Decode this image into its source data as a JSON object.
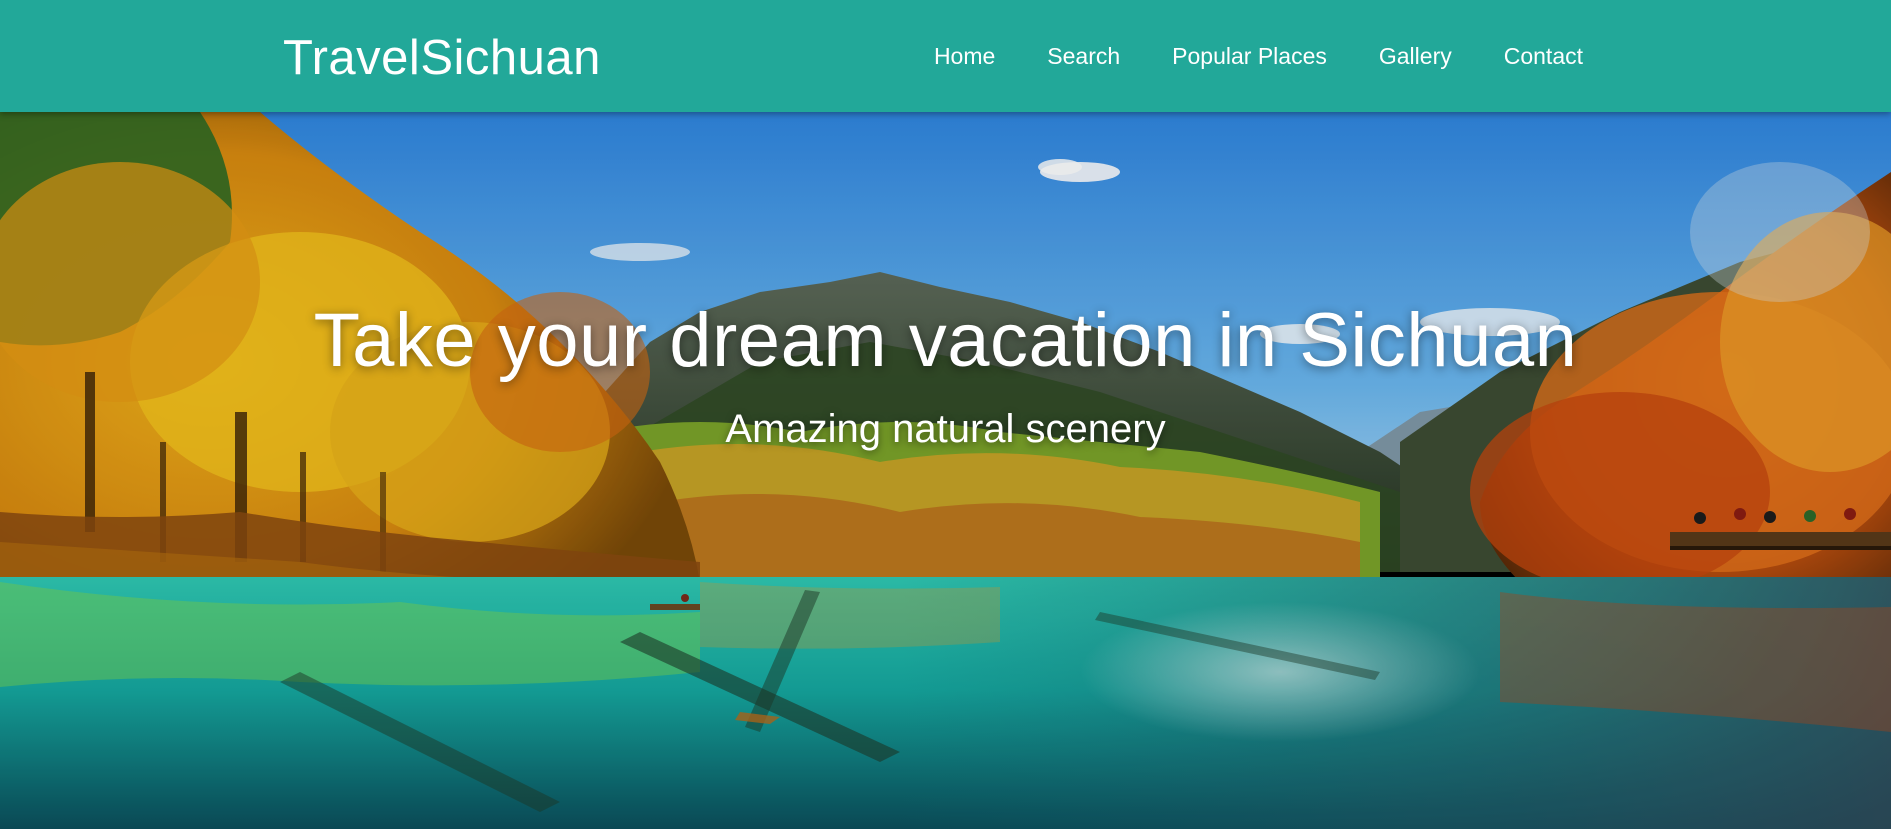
{
  "colors": {
    "navbar": "#22a899",
    "text": "#ffffff",
    "sky_top": "#2f86e0",
    "lake": "#18b8a8"
  },
  "navbar": {
    "brand": "TravelSichuan",
    "links": [
      {
        "label": "Home"
      },
      {
        "label": "Search"
      },
      {
        "label": "Popular Places"
      },
      {
        "label": "Gallery"
      },
      {
        "label": "Contact"
      }
    ]
  },
  "hero": {
    "image": "jiuzhaigou-lake-autumn-scenery",
    "title": "Take your dream vacation in Sichuan",
    "subtitle": "Amazing natural scenery"
  }
}
